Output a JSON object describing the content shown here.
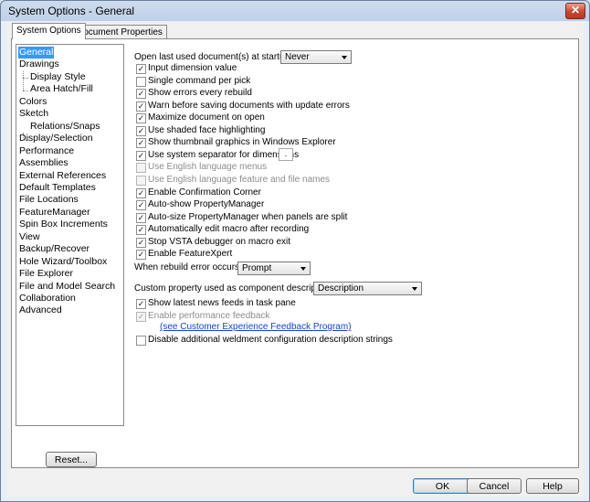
{
  "window": {
    "title": "System Options - General",
    "close_glyph": "✕"
  },
  "tabs": [
    {
      "label": "System Options"
    },
    {
      "label": "Document Properties"
    }
  ],
  "tree": [
    {
      "label": "General"
    },
    {
      "label": "Drawings"
    },
    {
      "label": "Display Style"
    },
    {
      "label": "Area Hatch/Fill"
    },
    {
      "label": "Colors"
    },
    {
      "label": "Sketch"
    },
    {
      "label": "Relations/Snaps"
    },
    {
      "label": "Display/Selection"
    },
    {
      "label": "Performance"
    },
    {
      "label": "Assemblies"
    },
    {
      "label": "External References"
    },
    {
      "label": "Default Templates"
    },
    {
      "label": "File Locations"
    },
    {
      "label": "FeatureManager"
    },
    {
      "label": "Spin Box Increments"
    },
    {
      "label": "View"
    },
    {
      "label": "Backup/Recover"
    },
    {
      "label": "Hole Wizard/Toolbox"
    },
    {
      "label": "File Explorer"
    },
    {
      "label": "File and Model Search"
    },
    {
      "label": "Collaboration"
    },
    {
      "label": "Advanced"
    }
  ],
  "startup": {
    "label": "Open last used document(s) at startup:",
    "value": "Never"
  },
  "options": [
    {
      "label": "Input dimension value",
      "checked": true,
      "enabled": true
    },
    {
      "label": "Single command per pick",
      "checked": false,
      "enabled": true
    },
    {
      "label": "Show errors every rebuild",
      "checked": true,
      "enabled": true
    },
    {
      "label": "Warn before saving documents with update errors",
      "checked": true,
      "enabled": true
    },
    {
      "label": "Maximize document on open",
      "checked": true,
      "enabled": true
    },
    {
      "label": "Use shaded face highlighting",
      "checked": true,
      "enabled": true
    },
    {
      "label": "Show thumbnail graphics in Windows Explorer",
      "checked": true,
      "enabled": true
    },
    {
      "label": "Use system separator for dimensions",
      "checked": true,
      "enabled": true
    },
    {
      "label": "Use English language menus",
      "checked": false,
      "enabled": false
    },
    {
      "label": "Use English language feature and file names",
      "checked": false,
      "enabled": false
    },
    {
      "label": "Enable Confirmation Corner",
      "checked": true,
      "enabled": true
    },
    {
      "label": "Auto-show PropertyManager",
      "checked": true,
      "enabled": true
    },
    {
      "label": "Auto-size PropertyManager when panels are split",
      "checked": true,
      "enabled": true
    },
    {
      "label": "Automatically edit macro after recording",
      "checked": true,
      "enabled": true
    },
    {
      "label": "Stop VSTA debugger on macro exit",
      "checked": true,
      "enabled": true
    },
    {
      "label": "Enable FeatureXpert",
      "checked": true,
      "enabled": true
    }
  ],
  "separator_value": ".",
  "rebuild": {
    "label": "When rebuild error occurs:",
    "value": "Prompt"
  },
  "custom_property": {
    "label": "Custom property used as component description:",
    "value": "Description"
  },
  "options2": [
    {
      "label": "Show latest news feeds in task pane",
      "checked": true,
      "enabled": true
    },
    {
      "label": "Enable performance feedback",
      "checked": true,
      "enabled": false
    }
  ],
  "feedback_link": "(see Customer Experience Feedback Program)",
  "weldment": {
    "label": "Disable additional weldment configuration description strings",
    "checked": false,
    "enabled": true
  },
  "buttons": {
    "reset": "Reset...",
    "ok": "OK",
    "cancel": "Cancel",
    "help": "Help"
  },
  "check_glyph": "✓"
}
